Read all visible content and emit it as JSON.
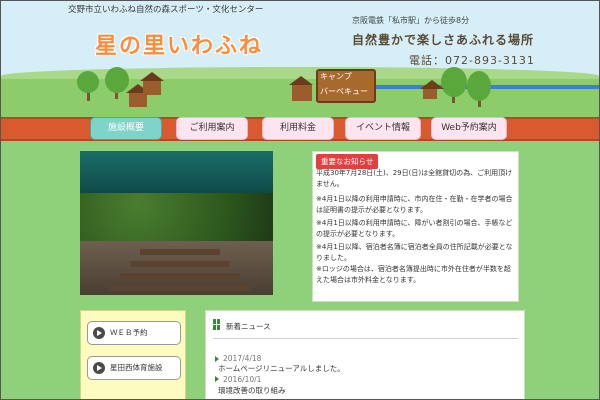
{
  "header": {
    "subtitle": "交野市立いわふね自然の森スポーツ・文化センター",
    "logo_text": "星の里いわふね",
    "access": "京阪電鉄「私市駅」から徒歩8分",
    "tagline": "自然豊かで楽しさあふれる場所",
    "tel": "電話：072-893-3131",
    "sign_line1": "キャンプ",
    "sign_line2": "バーベキュー"
  },
  "nav": {
    "items": [
      "施設概要",
      "ご利用案内",
      "利用料金",
      "イベント情報",
      "Web予約案内"
    ],
    "active_index": 0
  },
  "notice": {
    "badge": "重要なお知らせ",
    "paragraphs": [
      "平成30年7月28日(土)、29日(日)は全館貸切の為、ご利用頂けません。",
      "※4月1日以降の利用申請時に、市内在住・在勤・在学者の場合は証明書の提示が必要となります。",
      "※4月1日以降の利用申請時に、障がい者割引の場合、手帳などの提示が必要となります。",
      "※4月1日以降、宿泊者名簿に宿泊者全員の住所記載が必要となりました。",
      "※ロッジの場合は、宿泊者名簿提出時に市外在住者が半数を超えた場合は市外料金となります。"
    ]
  },
  "sidebar": {
    "buttons": [
      "ＷＥＢ予約",
      "星田西体育施設"
    ]
  },
  "news": {
    "heading": "新着ニュース",
    "items": [
      {
        "date": "2017/4/18",
        "title": "ホームページリニューアルしました。"
      },
      {
        "date": "2016/10/1",
        "title": "環境改善の取り組み"
      }
    ]
  },
  "colors": {
    "background": "#8fd07a",
    "nav_bar": "#d95a2e",
    "nav_active": "#7fd3c8",
    "nav_button": "#fde4ee",
    "logo": "#ff8c3a",
    "badge": "#e04040"
  }
}
